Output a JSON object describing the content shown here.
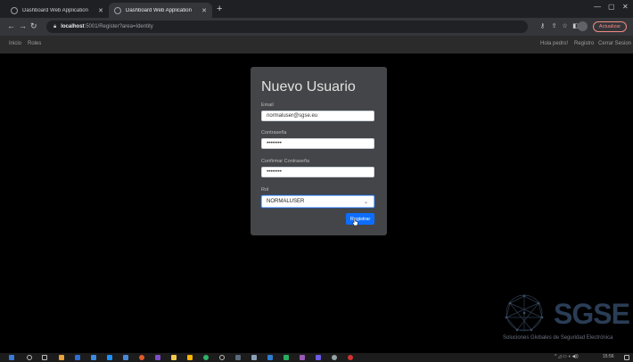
{
  "browser": {
    "tabs": [
      {
        "label": "Dashboard Web Application",
        "active": false
      },
      {
        "label": "Dashboard Web Application",
        "active": true
      }
    ],
    "url": {
      "host": "localhost",
      "rest": ":5001/Register?area=Identity"
    },
    "update_label": "Actualizar"
  },
  "app_nav": {
    "left_items": [
      "Inicio",
      "Roles"
    ],
    "greeting": "Hola pedro!",
    "register": "Registro",
    "logout": "Cerrar Sesion"
  },
  "form": {
    "title": "Nuevo Usuario",
    "email_label": "Email",
    "email_value": "normaluser@sgse.eu",
    "password_label": "Contraseña",
    "password_value": "••••••••",
    "confirm_label": "Confirmar Contraseña",
    "confirm_value": "••••••••",
    "role_label": "Rol",
    "role_value": "NORMALUSER",
    "submit_label": "Registrar"
  },
  "watermark": {
    "logo": "SGSE",
    "subtitle": "Soluciones Globales de Seguridad Electrónica"
  },
  "taskbar": {
    "clock": "15:56"
  },
  "colors": {
    "primary": "#0d6efd",
    "card": "#444548",
    "background": "#000000",
    "navbar": "#2b2b2b"
  }
}
